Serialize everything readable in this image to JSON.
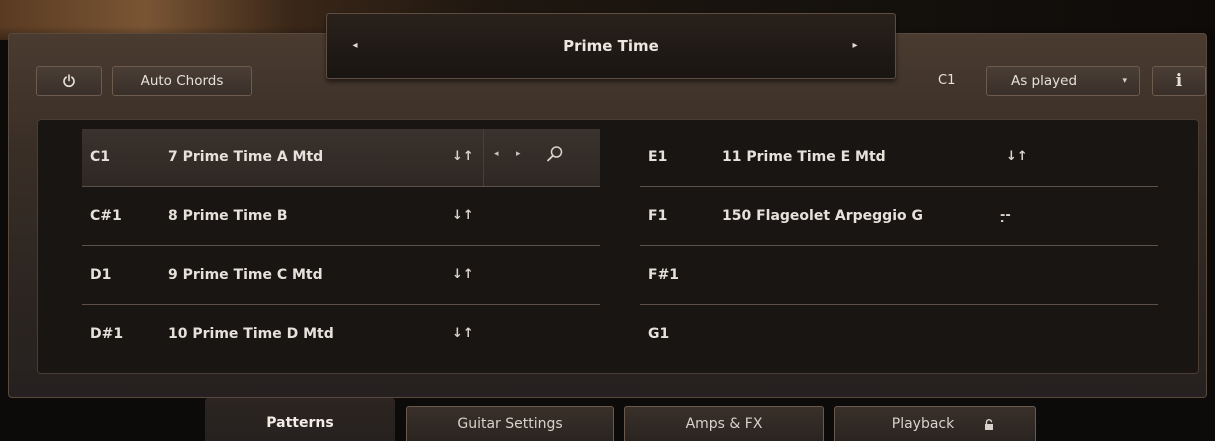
{
  "header": {
    "preset_name": "Prime Time",
    "prev_arrow": "◂",
    "next_arrow": "▸",
    "auto_chords_label": "Auto Chords",
    "key_label": "C1",
    "mode_value": "As played",
    "mode_caret": "▾",
    "info_label": "i"
  },
  "patterns": {
    "left": [
      {
        "note": "C1",
        "name": "7  Prime Time A Mtd",
        "icon": "↓↑",
        "selected": true
      },
      {
        "note": "C#1",
        "name": "8  Prime Time B",
        "icon": "↓↑"
      },
      {
        "note": "D1",
        "name": "9  Prime Time C Mtd",
        "icon": "↓↑"
      },
      {
        "note": "D#1",
        "name": "10  Prime Time D Mtd",
        "icon": "↓↑"
      }
    ],
    "right": [
      {
        "note": "E1",
        "name": "11  Prime Time E Mtd",
        "icon": "↓↑"
      },
      {
        "note": "F1",
        "name": "150  Flageolet Arpeggio G",
        "icon": "-̣-"
      },
      {
        "note": "F#1",
        "name": "",
        "icon": ""
      },
      {
        "note": "G1",
        "name": "",
        "icon": ""
      }
    ],
    "selected_tools": {
      "prev": "◂",
      "next": "▸",
      "search_icon": "search-icon"
    }
  },
  "tabs": [
    {
      "label": "Patterns",
      "active": true
    },
    {
      "label": "Guitar Settings",
      "active": false
    },
    {
      "label": "Amps & FX",
      "active": false
    },
    {
      "label": "Playback",
      "active": false
    }
  ],
  "colors": {
    "panel": "#2c2521",
    "dark": "#191513",
    "text": "#e6e1da",
    "divider": "#5d5048"
  }
}
